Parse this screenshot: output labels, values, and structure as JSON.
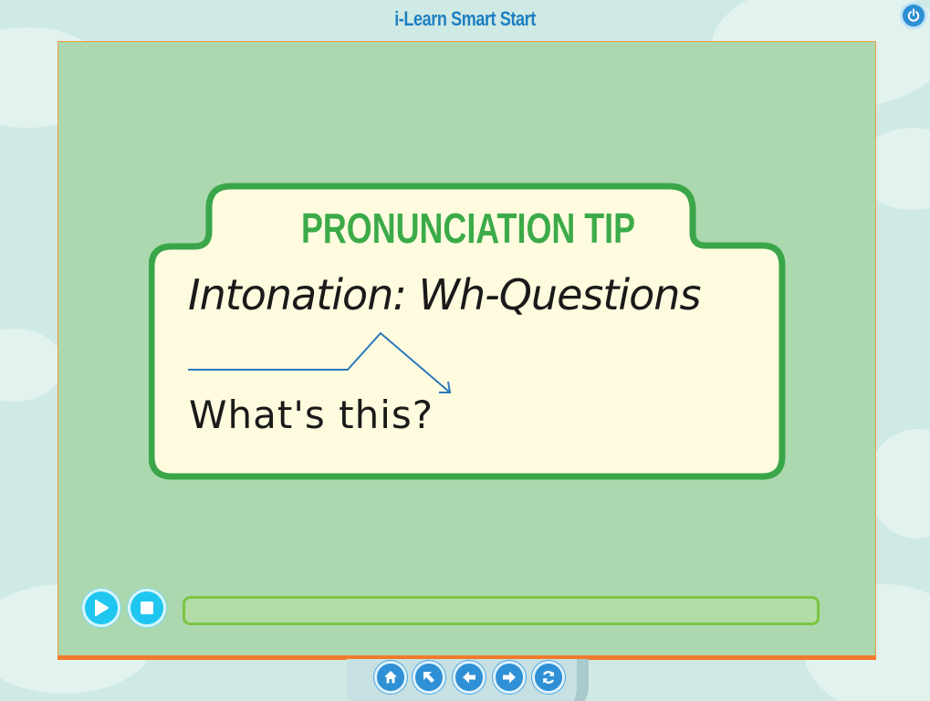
{
  "app": {
    "title": "i-Learn Smart Start"
  },
  "tip": {
    "heading": "PRONUNCIATION TIP",
    "subtitle": "Intonation: Wh-Questions",
    "example": "What's this?"
  },
  "player": {
    "progress": 0.0
  },
  "icons": {
    "power": "power-icon",
    "play": "play-icon",
    "stop": "stop-icon",
    "home": "home-icon",
    "back_arrow": "arrow-up-left-icon",
    "previous": "arrow-left-icon",
    "next": "arrow-right-icon",
    "refresh": "refresh-icon"
  },
  "colors": {
    "title_blue": "#1d7fc2",
    "stage_green": "#abd8ae",
    "card_border_green": "#3aa649",
    "card_fill": "#fffbdf",
    "heading_green": "#3bab49",
    "button_cyan": "#1fc7f0",
    "nav_blue": "#2f90d6"
  }
}
